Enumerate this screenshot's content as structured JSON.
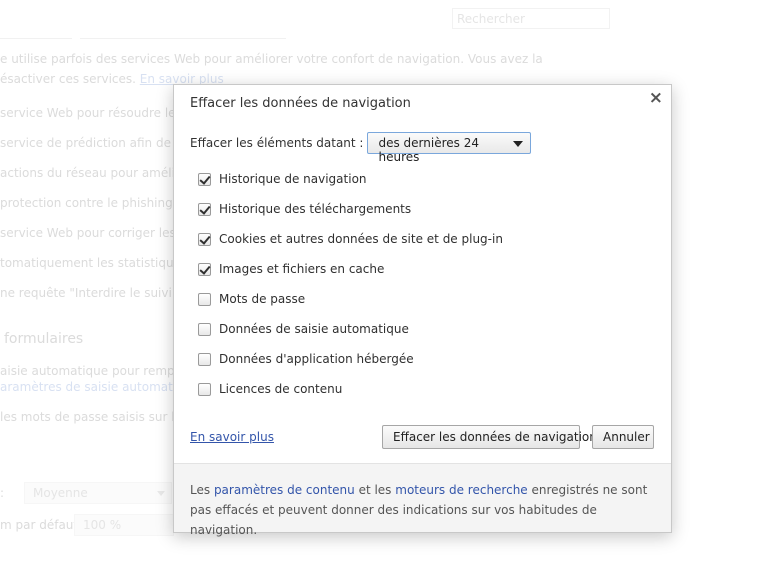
{
  "background": {
    "search_placeholder": "Rechercher",
    "privacy_line1": "e utilise parfois des services Web pour améliorer votre confort de navigation. Vous avez la",
    "privacy_line2_prefix": "ésactiver ces services.",
    "privacy_learn_more": "En savoir plus",
    "items": [
      "service Web pour résoudre les err",
      "service de prédiction afin de com",
      "actions du réseau pour améliorer",
      "protection contre le phishing et le",
      "service Web pour corriger les erre",
      "tomatiquement les statistiques d",
      "ne requête \"Interdire le suivi\" avec"
    ],
    "forms_section": "formulaires",
    "autofill_line": "aisie automatique pour remplir le",
    "autofill_link": "aramètres de saisie automatique",
    "passwords_line": "les mots de passe saisis sur le We",
    "font_size_label": ":",
    "font_size_value": "Moyenne",
    "zoom_label": "m par défaut :",
    "zoom_value": "100 %"
  },
  "dialog": {
    "title": "Effacer les données de navigation",
    "close_symbol": "×",
    "period_label": "Effacer les éléments datant :",
    "period_value": "des dernières 24 heures",
    "options": [
      {
        "label": "Historique de navigation",
        "checked": true
      },
      {
        "label": "Historique des téléchargements",
        "checked": true
      },
      {
        "label": "Cookies et autres données de site et de plug-in",
        "checked": true
      },
      {
        "label": "Images et fichiers en cache",
        "checked": true
      },
      {
        "label": "Mots de passe",
        "checked": false
      },
      {
        "label": "Données de saisie automatique",
        "checked": false
      },
      {
        "label": "Données d'application hébergée",
        "checked": false
      },
      {
        "label": "Licences de contenu",
        "checked": false
      }
    ],
    "learn_more": "En savoir plus",
    "clear_button": "Effacer les données de navigation",
    "cancel_button": "Annuler",
    "footer": {
      "part1": "Les ",
      "link1": "paramètres de contenu",
      "part2": " et les ",
      "link2": "moteurs de recherche",
      "part3": " enregistrés ne sont pas effacés et peuvent donner des indications sur vos habitudes de navigation."
    }
  }
}
